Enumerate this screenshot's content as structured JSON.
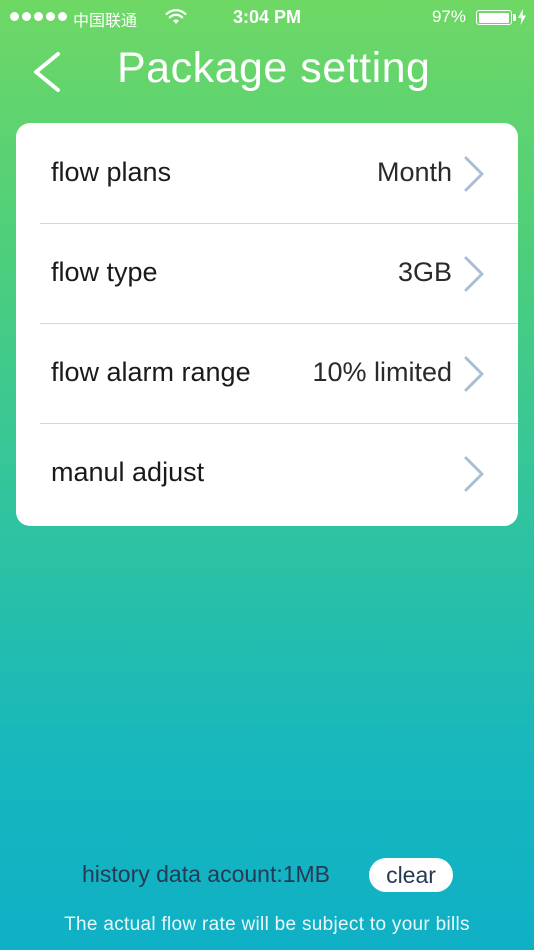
{
  "status_bar": {
    "carrier": "中国联通",
    "time": "3:04 PM",
    "battery_percent": "97%",
    "battery_level": 0.97,
    "signal_bars": 5
  },
  "header": {
    "title": "Package setting",
    "back_icon": "chevron-left-icon"
  },
  "settings": [
    {
      "label": "flow plans",
      "value": "Month"
    },
    {
      "label": "flow type",
      "value": "3GB"
    },
    {
      "label": "flow alarm range",
      "value": "10% limited"
    },
    {
      "label": "manul adjust",
      "value": ""
    }
  ],
  "footer": {
    "history_text": "history data acount:1MB",
    "clear_label": "clear",
    "disclaimer": "The actual flow rate will be subject to your bills"
  },
  "colors": {
    "gradient_top": "#6fd865",
    "gradient_bottom": "#0fb0c6",
    "chevron": "#a9bdd3",
    "footer_text": "#263a55"
  }
}
